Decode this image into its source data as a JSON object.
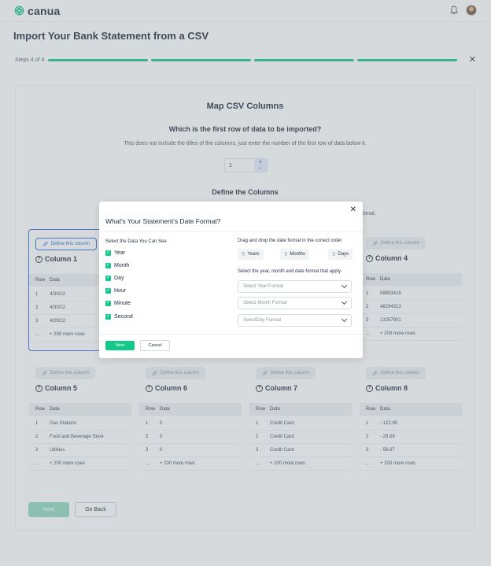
{
  "app": {
    "brand": "canua"
  },
  "page": {
    "title": "Import Your Bank Statement from a CSV"
  },
  "steps": {
    "label": "Steps 4 of 4",
    "completed": 4,
    "total": 4
  },
  "card": {
    "title": "Map CSV Columns",
    "question": "Which is the first row of data to be imported?",
    "hint": "This does not include the titles of the columns, just enter the number of the first row of data below it.",
    "row_value": "1",
    "define_title": "Define the Columns",
    "optional_tail": "ptional."
  },
  "columns": [
    {
      "define": "Define this column",
      "name": "Column 1",
      "head_row": "Row",
      "head_data": "Data",
      "rows": [
        [
          "1",
          "4/30/22"
        ],
        [
          "2",
          "4/30/22"
        ],
        [
          "3",
          "4/29/22"
        ],
        [
          "...",
          "+ 200 more rows"
        ]
      ]
    },
    {
      "define": "Define this column",
      "name": "Column 4",
      "head_row": "Row",
      "head_data": "Data",
      "rows": [
        [
          "1",
          "58893418"
        ],
        [
          "2",
          "48294313"
        ],
        [
          "3",
          "13257901"
        ],
        [
          "...",
          "+ 200 more rows"
        ]
      ]
    },
    {
      "define": "Define this column",
      "name": "Column 5",
      "head_row": "Row",
      "head_data": "Data",
      "rows": [
        [
          "1",
          "Gas Stations"
        ],
        [
          "2",
          "Food and Beverage Store"
        ],
        [
          "3",
          "Utilities"
        ],
        [
          "...",
          "+ 200 more rows"
        ]
      ]
    },
    {
      "define": "Define this column",
      "name": "Column 6",
      "head_row": "Row",
      "head_data": "Data",
      "rows": [
        [
          "1",
          "0"
        ],
        [
          "2",
          "0"
        ],
        [
          "3",
          "0"
        ],
        [
          "...",
          "+ 200 more rows"
        ]
      ]
    },
    {
      "define": "Define this column",
      "name": "Column 7",
      "head_row": "Row",
      "head_data": "Data",
      "rows": [
        [
          "1",
          "Credit Card"
        ],
        [
          "2",
          "Credit Card"
        ],
        [
          "3",
          "Credit Card"
        ],
        [
          "...",
          "+ 200 more rows"
        ]
      ]
    },
    {
      "define": "Define this column",
      "name": "Column 8",
      "head_row": "Row",
      "head_data": "Data",
      "rows": [
        [
          "1",
          "- 122.99"
        ],
        [
          "2",
          "- 29.89"
        ],
        [
          "3",
          "- 56.67"
        ],
        [
          "...",
          "+ 200 more rows"
        ]
      ]
    }
  ],
  "footer": {
    "next_label": "Next",
    "back_label": "Go Back"
  },
  "modal": {
    "title": "What's Your Statement's Date Format?",
    "left_label": "Select the Data You Can See",
    "options": [
      "Year",
      "Month",
      "Day",
      "Hour",
      "Minute",
      "Second"
    ],
    "drag_label": "Drag and drop the date format in the correct order",
    "chips": [
      "Years",
      "Months",
      "Days"
    ],
    "select_label": "Select the year, month and date format that apply",
    "selects": [
      "Select Year Format",
      "Select Month Format",
      "SelectDay Format"
    ],
    "next_label": "Next",
    "cancel_label": "Cancel"
  },
  "colors": {
    "accent": "#13c98a",
    "link": "#2b6cd8"
  }
}
